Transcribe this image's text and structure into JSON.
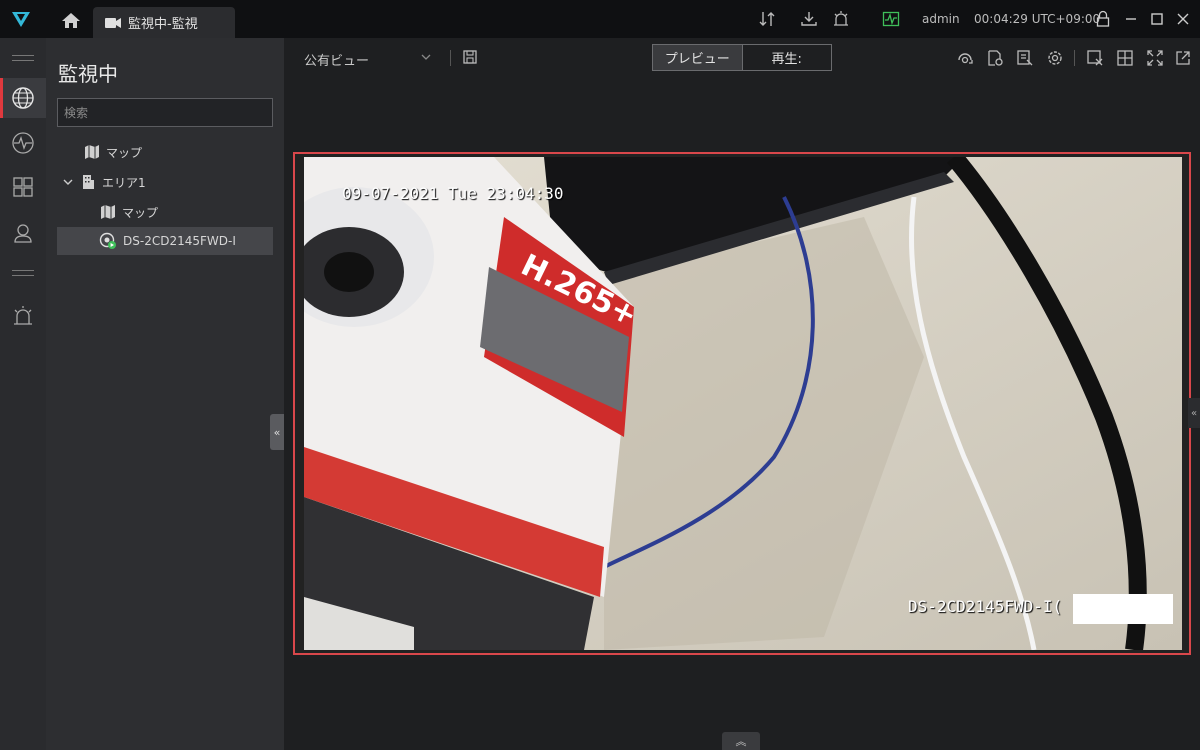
{
  "titlebar": {
    "tab_label": "監視中-監視",
    "user": "admin",
    "time": "00:04:29 UTC+09:00"
  },
  "rail": {
    "items": [
      "globe-icon",
      "pulse-icon",
      "layout-icon",
      "user-icon",
      "alarm-icon"
    ]
  },
  "panel": {
    "title": "監視中",
    "search_placeholder": "検索",
    "tree": {
      "root_map": "マップ",
      "area": "エリア1",
      "area_map": "マップ",
      "camera": "DS-2CD2145FWD-I"
    }
  },
  "main": {
    "view_name": "公有ビュー",
    "mode_preview": "プレビュー",
    "mode_playback": "再生:",
    "osd_datetime": "09-07-2021 Tue 23:04:30",
    "osd_camera": "DS-2CD2145FWD-I("
  },
  "colors": {
    "accent": "#e0393e",
    "logo": "#33b8d8",
    "ok": "#3fbf5a"
  }
}
